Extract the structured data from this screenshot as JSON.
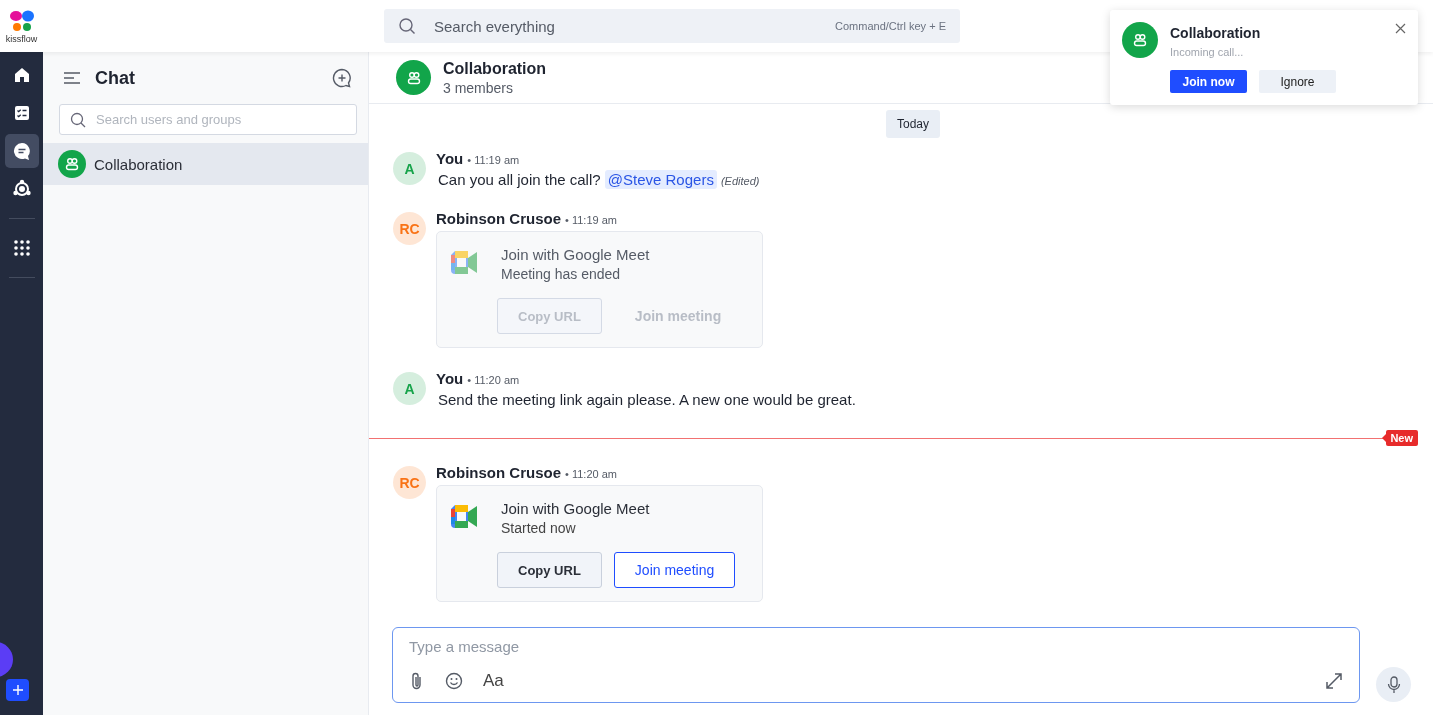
{
  "app": {
    "logo_text": "kissflow"
  },
  "search": {
    "placeholder": "Search everything",
    "shortcut": "Command/Ctrl key + E"
  },
  "rail": [
    {
      "kind": "home",
      "selected": false
    },
    {
      "kind": "tasks",
      "selected": false
    },
    {
      "kind": "chat",
      "selected": true
    },
    {
      "kind": "flows",
      "selected": false
    },
    {
      "kind": "apps",
      "selected": false
    }
  ],
  "sidebar": {
    "title": "Chat",
    "search_placeholder": "Search users and groups",
    "items": [
      {
        "name": "Collaboration",
        "selected": true
      }
    ]
  },
  "conversation": {
    "title": "Collaboration",
    "subtitle": "3 members"
  },
  "day_label": "Today",
  "messages": [
    {
      "kind": "text",
      "author": "You",
      "initials": "A",
      "color": "#16a34a",
      "time": "• 11:19 am",
      "text": "Can you all join the call?",
      "mention": "@Steve Rogers",
      "note": "(Edited)"
    },
    {
      "kind": "meet",
      "author": "Robinson Crusoe",
      "initials": "RC",
      "color": "#f97316",
      "time": "• 11:19 am",
      "title": "Join with Google Meet",
      "status": "Meeting has ended",
      "disabled": true,
      "buttons": [
        "Copy URL",
        "Join meeting"
      ]
    },
    {
      "kind": "text",
      "author": "You",
      "initials": "A",
      "color": "#16a34a",
      "time": "• 11:20 am",
      "text": "Send the meeting link again please. A new one would be great."
    },
    {
      "kind": "divider",
      "label": "New"
    },
    {
      "kind": "meet",
      "author": "Robinson Crusoe",
      "initials": "RC",
      "color": "#f97316",
      "time": "• 11:20 am",
      "title": "Join with Google Meet",
      "status": "Started now",
      "disabled": false,
      "buttons": [
        "Copy URL",
        "Join meeting"
      ]
    }
  ],
  "composer": {
    "placeholder": "Type a message",
    "format_label": "Aa"
  },
  "notification": {
    "title": "Collaboration",
    "subtitle": "Incoming call...",
    "buttons": [
      "Join now",
      "Ignore"
    ]
  }
}
